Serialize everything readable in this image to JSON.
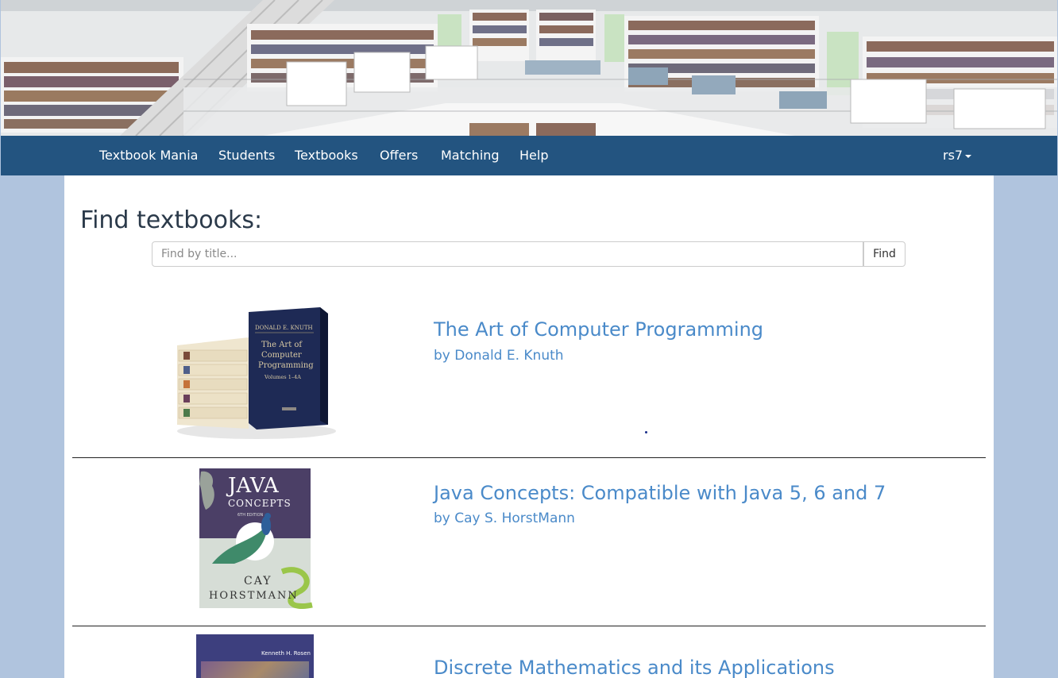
{
  "navbar": {
    "brand": "Textbook Mania",
    "items": [
      "Students",
      "Textbooks",
      "Offers",
      "Matching",
      "Help"
    ],
    "user": "rs7"
  },
  "page": {
    "title": "Find textbooks:"
  },
  "search": {
    "placeholder": "Find by title...",
    "button_label": "Find"
  },
  "books": [
    {
      "title": "The Art of Computer Programming",
      "author": "by Donald E. Knuth",
      "cover_text": [
        "DONALD E. KNUTH",
        "The Art of",
        "Computer",
        "Programming",
        "Volumes 1–4A"
      ]
    },
    {
      "title": "Java Concepts: Compatible with Java 5, 6 and 7",
      "author": "by Cay S. HorstMann",
      "cover_text": [
        "JAVA",
        "CONCEPTS",
        "6TH EDITION",
        "CAY",
        "HORSTMANN"
      ]
    },
    {
      "title": "Discrete Mathematics and its Applications",
      "author": "",
      "cover_text": [
        "Kenneth H. Rosen"
      ]
    }
  ],
  "colors": {
    "navbar": "#235480",
    "page_background": "#b0c4de",
    "link": "#4a8ac9",
    "title_text": "#2b3a4a"
  }
}
